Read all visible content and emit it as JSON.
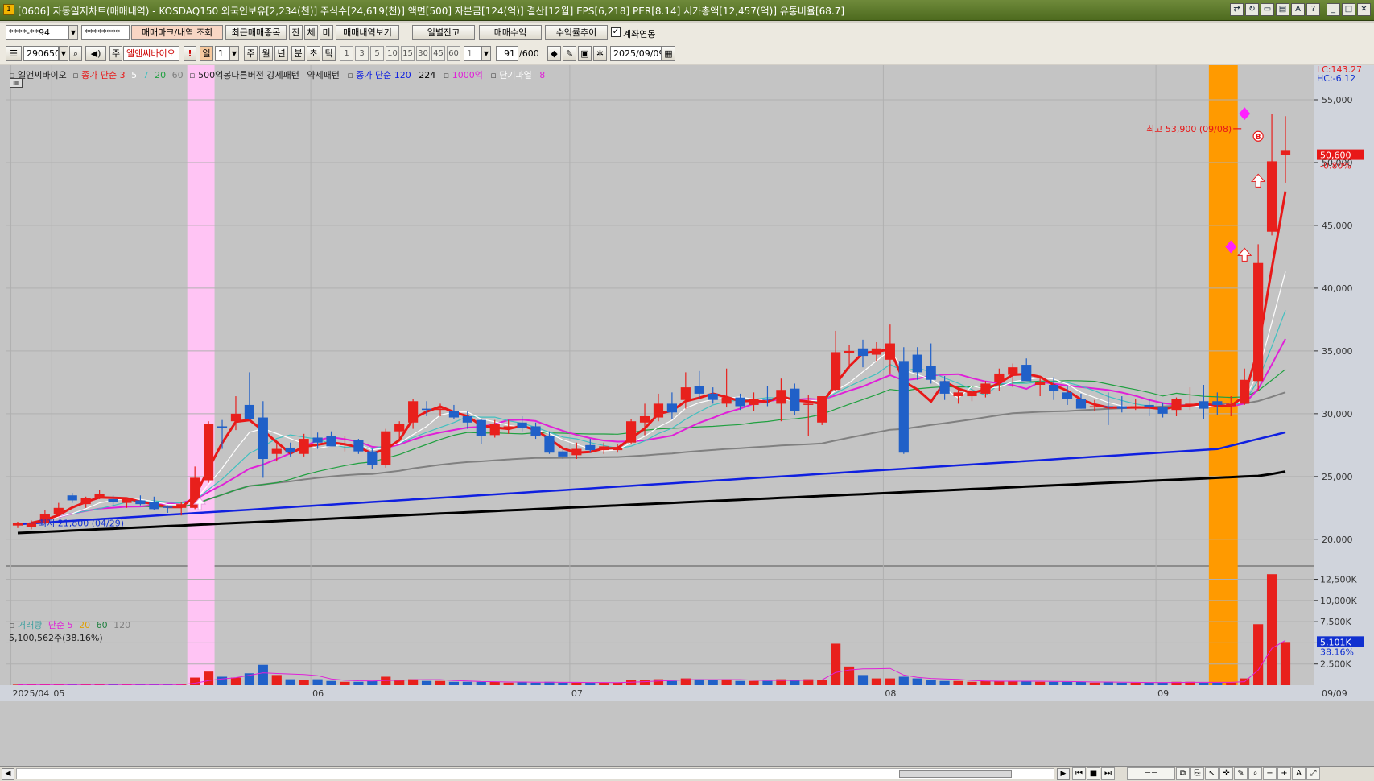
{
  "window": {
    "icon_text": "1",
    "title": "[0606] 자동일지차트(매매내역) - KOSDAQ150 외국인보유[2,234(천)] 주식수[24,619(천)] 액면[500] 자본금[124(억)] 결산[12월] EPS[6,218] PER[8.14] 시가총액[12,457(억)] 유통비율[68.7]"
  },
  "toolbar1": {
    "account": "****-**94",
    "password": "********",
    "btn_trade_mark": "매매마크/내역 조회",
    "btn_recent": "최근매매종목",
    "btn_jan": "잔",
    "btn_che": "체",
    "btn_mi": "미",
    "btn_history": "매매내역보기",
    "btn_daily_balance": "일별잔고",
    "btn_trade_profit": "매매수익",
    "btn_return_trend": "수익률추이",
    "account_link_label": "계좌연동",
    "account_link_checked": "✓"
  },
  "toolbar2": {
    "code": "290650",
    "stock_prefix": "주",
    "stock_name": "엘앤씨바이오",
    "alert": "!",
    "day": "일",
    "period_value": "1",
    "periods": [
      "주",
      "월",
      "년",
      "분",
      "초",
      "틱"
    ],
    "intervals": [
      "1",
      "3",
      "5",
      "10",
      "15",
      "30",
      "45",
      "60"
    ],
    "interval_value": "1",
    "count": "91",
    "count_total": "/600",
    "date": "2025/09/09"
  },
  "legend": {
    "stock_name": "엘앤씨바이오",
    "ma_label": "종가 단순 3",
    "ma5": "5",
    "ma7": "7",
    "ma20": "20",
    "ma60": "60",
    "pattern1": "500억봉다른버전 강세패턴",
    "pattern2": "약세패턴",
    "long_ma_label": "종가 단순 120",
    "ma224": "224",
    "marker_1000": "1000억",
    "short_overheat": "단기과열",
    "short_overheat_val": "8",
    "lc_label": "LC:143.27",
    "hc_label": "HC:-6.12"
  },
  "annotations": {
    "high": "최고 53,900 (09/08)",
    "low": "최저 21,800 (04/29)",
    "current_price": "50,600",
    "current_change": "-0.80%",
    "b_marker": "B"
  },
  "volume_legend": {
    "title": "거래량",
    "ma": "단순 5",
    "ma20": "20",
    "ma60": "60",
    "ma120": "120",
    "current": "5,100,562주(38.16%)",
    "current_label": "5,101K",
    "current_pct": "38.16%"
  },
  "colors": {
    "bg": "#c4c4c4",
    "up": "#e8201c",
    "down": "#2060c8",
    "ma3": "#e81818",
    "ma5": "#ffffff",
    "ma7": "#40c0c0",
    "ma20": "#e020d8",
    "ma60": "#20a040",
    "ma120": "#808080",
    "ma224": "#1020e0",
    "ma_long": "#000000",
    "pink_band": "#ffc4f4",
    "orange_band": "#ff9a00"
  },
  "chart_data": {
    "type": "candlestick",
    "y_range": [
      18000,
      57500
    ],
    "y_ticks": [
      55000,
      50000,
      45000,
      40000,
      35000,
      30000,
      25000,
      20000
    ],
    "y_tick_labels": [
      "55,000",
      "50,000",
      "45,000",
      "40,000",
      "35,000",
      "30,000",
      "25,000",
      "20,000"
    ],
    "x_labels": [
      {
        "label": "2025/04",
        "index": 0
      },
      {
        "label": "05",
        "index": 3
      },
      {
        "label": "06",
        "index": 22
      },
      {
        "label": "07",
        "index": 41
      },
      {
        "label": "08",
        "index": 64
      },
      {
        "label": "09",
        "index": 84
      }
    ],
    "x_end_label": "09/09",
    "highlight_pink_index": 13,
    "highlight_orange_index": [
      88,
      89
    ],
    "candles": [
      [
        21100,
        21400,
        20900,
        21300
      ],
      [
        21000,
        21500,
        20800,
        21300
      ],
      [
        21300,
        22300,
        21200,
        22000
      ],
      [
        22000,
        22900,
        21900,
        22500
      ],
      [
        23500,
        23700,
        22900,
        23100
      ],
      [
        22800,
        23400,
        22500,
        23300
      ],
      [
        23300,
        23900,
        23200,
        23600
      ],
      [
        23200,
        23500,
        22600,
        23000
      ],
      [
        22900,
        23300,
        22500,
        23200
      ],
      [
        23100,
        23500,
        22700,
        22800
      ],
      [
        23000,
        23400,
        22300,
        22400
      ],
      [
        22600,
        22700,
        22100,
        22500
      ],
      [
        22500,
        23000,
        21900,
        22800
      ],
      [
        22500,
        25800,
        22400,
        24900
      ],
      [
        24700,
        29400,
        24500,
        29200
      ],
      [
        29000,
        29500,
        27200,
        28900
      ],
      [
        29400,
        31400,
        28700,
        30000
      ],
      [
        30700,
        33300,
        29500,
        29600
      ],
      [
        29700,
        31000,
        24900,
        26400
      ],
      [
        26800,
        27600,
        26200,
        27200
      ],
      [
        27300,
        27700,
        26600,
        26900
      ],
      [
        26800,
        28400,
        26600,
        28000
      ],
      [
        28100,
        28500,
        27200,
        27700
      ],
      [
        28200,
        28600,
        27500,
        27400
      ],
      [
        27500,
        28200,
        27000,
        27600
      ],
      [
        27900,
        28000,
        26800,
        27000
      ],
      [
        27000,
        27200,
        25600,
        25900
      ],
      [
        25900,
        28800,
        25700,
        28600
      ],
      [
        28600,
        29400,
        27800,
        29200
      ],
      [
        29300,
        31200,
        28800,
        31000
      ],
      [
        30400,
        31000,
        29800,
        30300
      ],
      [
        30300,
        30800,
        29800,
        30400
      ],
      [
        30200,
        30700,
        29600,
        29700
      ],
      [
        29800,
        30200,
        28800,
        29300
      ],
      [
        29500,
        29600,
        27600,
        28200
      ],
      [
        28300,
        29500,
        28100,
        29200
      ],
      [
        28800,
        29500,
        28400,
        29000
      ],
      [
        29300,
        29800,
        28600,
        28900
      ],
      [
        29000,
        29300,
        28000,
        28200
      ],
      [
        28200,
        28600,
        26800,
        26900
      ],
      [
        27000,
        27300,
        26400,
        26600
      ],
      [
        26700,
        27700,
        26400,
        27200
      ],
      [
        27500,
        28000,
        26900,
        27100
      ],
      [
        27100,
        27700,
        26800,
        27400
      ],
      [
        27100,
        27600,
        26900,
        27300
      ],
      [
        27700,
        29600,
        27600,
        29400
      ],
      [
        29300,
        30800,
        28300,
        29800
      ],
      [
        29700,
        31600,
        29400,
        30800
      ],
      [
        30800,
        31700,
        29600,
        30100
      ],
      [
        31100,
        33300,
        30400,
        32100
      ],
      [
        32200,
        33400,
        31200,
        31600
      ],
      [
        31600,
        32100,
        30800,
        31100
      ],
      [
        30800,
        33600,
        30500,
        31300
      ],
      [
        31300,
        31600,
        30300,
        30600
      ],
      [
        30700,
        31700,
        30200,
        31200
      ],
      [
        31200,
        32200,
        30600,
        31100
      ],
      [
        30800,
        32800,
        29400,
        31900
      ],
      [
        32000,
        32400,
        29900,
        30200
      ],
      [
        30700,
        31500,
        28200,
        30800
      ],
      [
        29300,
        31400,
        29100,
        31400
      ],
      [
        31900,
        36600,
        31800,
        34900
      ],
      [
        34800,
        35500,
        33600,
        35000
      ],
      [
        35200,
        35900,
        33700,
        34600
      ],
      [
        34700,
        35700,
        34200,
        35200
      ],
      [
        34300,
        37100,
        33200,
        35600
      ],
      [
        34200,
        35300,
        26800,
        26900
      ],
      [
        34700,
        35300,
        32700,
        33300
      ],
      [
        33800,
        35600,
        32400,
        32700
      ],
      [
        32600,
        33000,
        31100,
        31600
      ],
      [
        31400,
        31900,
        30800,
        31700
      ],
      [
        31400,
        32000,
        31000,
        31700
      ],
      [
        31600,
        32600,
        31300,
        32400
      ],
      [
        32500,
        33600,
        31800,
        33200
      ],
      [
        33100,
        34000,
        32100,
        33700
      ],
      [
        33900,
        34400,
        33200,
        32600
      ],
      [
        32300,
        32900,
        31400,
        32500
      ],
      [
        32300,
        32900,
        31100,
        31800
      ],
      [
        31700,
        32200,
        30700,
        31200
      ],
      [
        31200,
        31600,
        30400,
        30400
      ],
      [
        30500,
        31100,
        30200,
        30600
      ],
      [
        30600,
        31700,
        29100,
        30500
      ],
      [
        30600,
        31400,
        30100,
        30400
      ],
      [
        30500,
        31200,
        30300,
        30600
      ],
      [
        30700,
        31200,
        29800,
        30500
      ],
      [
        30500,
        30900,
        29700,
        30000
      ],
      [
        30300,
        31300,
        29800,
        31200
      ],
      [
        30800,
        32100,
        30300,
        30800
      ],
      [
        31000,
        32300,
        29600,
        30400
      ],
      [
        31000,
        31700,
        29900,
        30700
      ],
      [
        30600,
        31400,
        29800,
        30800
      ],
      [
        30800,
        33600,
        30700,
        32700
      ],
      [
        32600,
        43500,
        31800,
        42000
      ],
      [
        44500,
        53900,
        44200,
        50100
      ],
      [
        50600,
        53700,
        48400,
        51000
      ]
    ],
    "ma_long_224": [
      20500,
      20550,
      20600,
      20650,
      20700,
      20750,
      20800,
      20850,
      20900,
      20950,
      21000,
      21050,
      21100,
      21150,
      21200,
      21250,
      21300,
      21350,
      21400,
      21450,
      21500,
      21550,
      21600,
      21650,
      21700,
      21750,
      21800,
      21850,
      21900,
      21950,
      22000,
      22050,
      22100,
      22150,
      22200,
      22250,
      22300,
      22350,
      22400,
      22450,
      22500,
      22550,
      22600,
      22650,
      22700,
      22750,
      22800,
      22850,
      22900,
      22950,
      23000,
      23050,
      23100,
      23150,
      23200,
      23250,
      23300,
      23350,
      23400,
      23450,
      23500,
      23550,
      23600,
      23650,
      23700,
      23750,
      23800,
      23850,
      23900,
      23950,
      24000,
      24050,
      24100,
      24150,
      24200,
      24250,
      24300,
      24350,
      24400,
      24450,
      24500,
      24550,
      24600,
      24650,
      24700,
      24750,
      24800,
      24850,
      24900,
      24950,
      25000,
      25050,
      25200,
      25400
    ]
  },
  "volume_data": {
    "y_ticks": [
      "12,500K",
      "10,000K",
      "7,500K",
      "5,000K",
      "2,500K"
    ],
    "y_values": [
      12500,
      10000,
      7500,
      5000,
      2500
    ],
    "y_max": 13500,
    "values": [
      60,
      80,
      70,
      90,
      100,
      80,
      70,
      80,
      60,
      70,
      60,
      70,
      80,
      900,
      1600,
      1000,
      900,
      1400,
      2400,
      1200,
      700,
      600,
      700,
      500,
      400,
      400,
      500,
      1000,
      600,
      700,
      500,
      500,
      400,
      400,
      400,
      400,
      300,
      400,
      300,
      400,
      300,
      300,
      300,
      300,
      300,
      600,
      600,
      700,
      500,
      800,
      700,
      600,
      700,
      500,
      500,
      500,
      700,
      600,
      700,
      600,
      4900,
      2200,
      1200,
      800,
      800,
      1000,
      800,
      600,
      500,
      500,
      400,
      500,
      500,
      500,
      500,
      400,
      400,
      400,
      400,
      300,
      400,
      300,
      300,
      300,
      300,
      400,
      400,
      300,
      300,
      300,
      800,
      7200,
      13100,
      5100
    ]
  }
}
